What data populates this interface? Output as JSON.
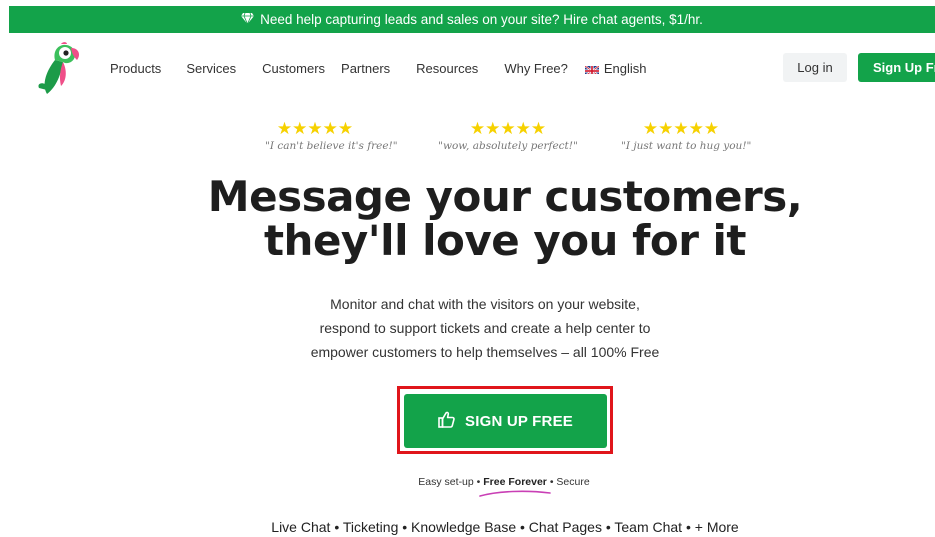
{
  "promo": {
    "icon": "diamond-icon",
    "text": "Need help capturing leads and sales on your site? Hire chat agents, $1/hr."
  },
  "nav": {
    "logo": "parrot-logo",
    "links": [
      "Products",
      "Services",
      "Customers",
      "Partners",
      "Resources",
      "Why Free?",
      "English"
    ],
    "login": "Log in",
    "signup": "Sign Up Free"
  },
  "reviews": [
    {
      "rating": 5,
      "quote": "\"I can't believe it's free!\""
    },
    {
      "rating": 5,
      "quote": "\"wow, absolutely perfect!\""
    },
    {
      "rating": 5,
      "quote": "\"I just want to hug you!\""
    }
  ],
  "hero": {
    "title_line1": "Message your customers,",
    "title_line2": "they'll love you for it",
    "sub_line1": "Monitor and chat with the visitors on your website,",
    "sub_line2": "respond to support tickets and create a help center to",
    "sub_line3": "empower customers to help themselves – all 100% Free"
  },
  "cta": {
    "label": "SIGN UP FREE",
    "icon": "thumbs-up-icon"
  },
  "trust": {
    "part1": "Easy set-up",
    "part2": "Free Forever",
    "part3": "Secure"
  },
  "features": "Live Chat • Ticketing • Knowledge Base • Chat Pages • Team Chat • + More",
  "colors": {
    "brand": "#13a34a",
    "star": "#f6d100",
    "highlight": "#e0151b",
    "underline": "#c93fb5"
  }
}
